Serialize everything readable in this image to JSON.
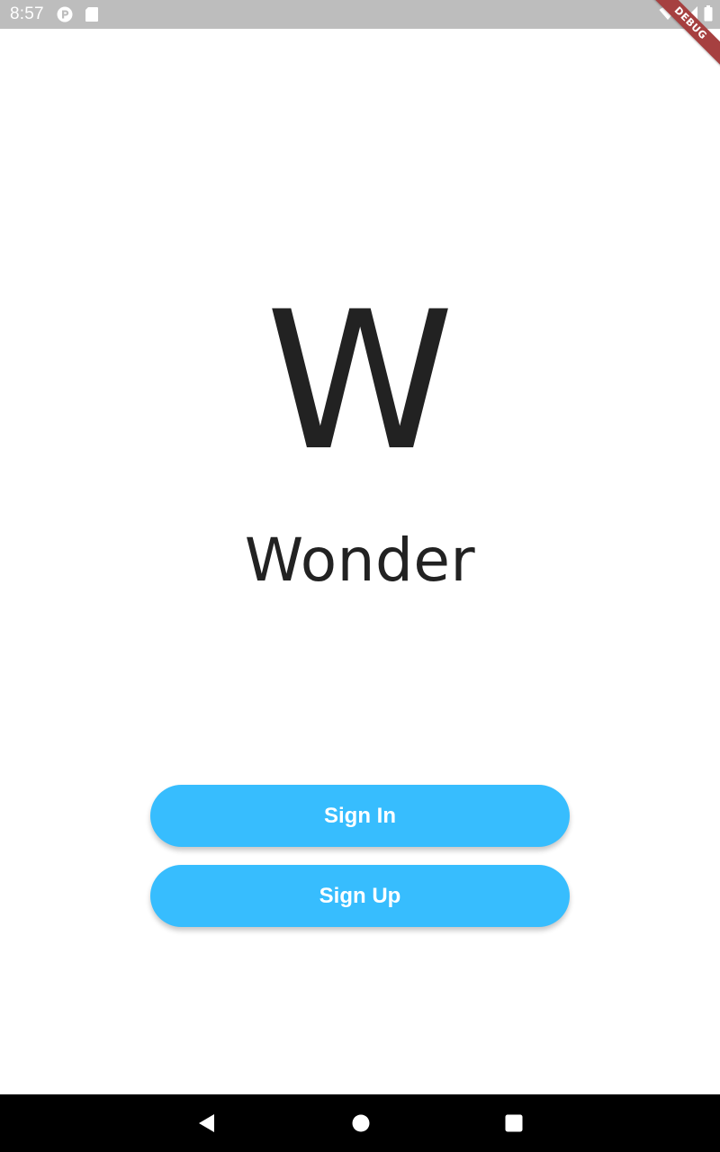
{
  "status_bar": {
    "time": "8:57",
    "left_icons": [
      "app-notification-icon",
      "sd-card-icon"
    ],
    "right_icons": [
      "wifi-icon",
      "cell-signal-icon",
      "battery-icon"
    ],
    "background": "#bdbdbd"
  },
  "debug_banner": {
    "label": "DEBUG",
    "color": "#a64040"
  },
  "logo": {
    "letter": "W"
  },
  "app": {
    "name": "Wonder"
  },
  "actions": {
    "sign_in_label": "Sign In",
    "sign_up_label": "Sign Up",
    "accent_color": "#37bdfe"
  },
  "nav_bar": {
    "buttons": [
      "back-icon",
      "home-icon",
      "recents-icon"
    ]
  }
}
